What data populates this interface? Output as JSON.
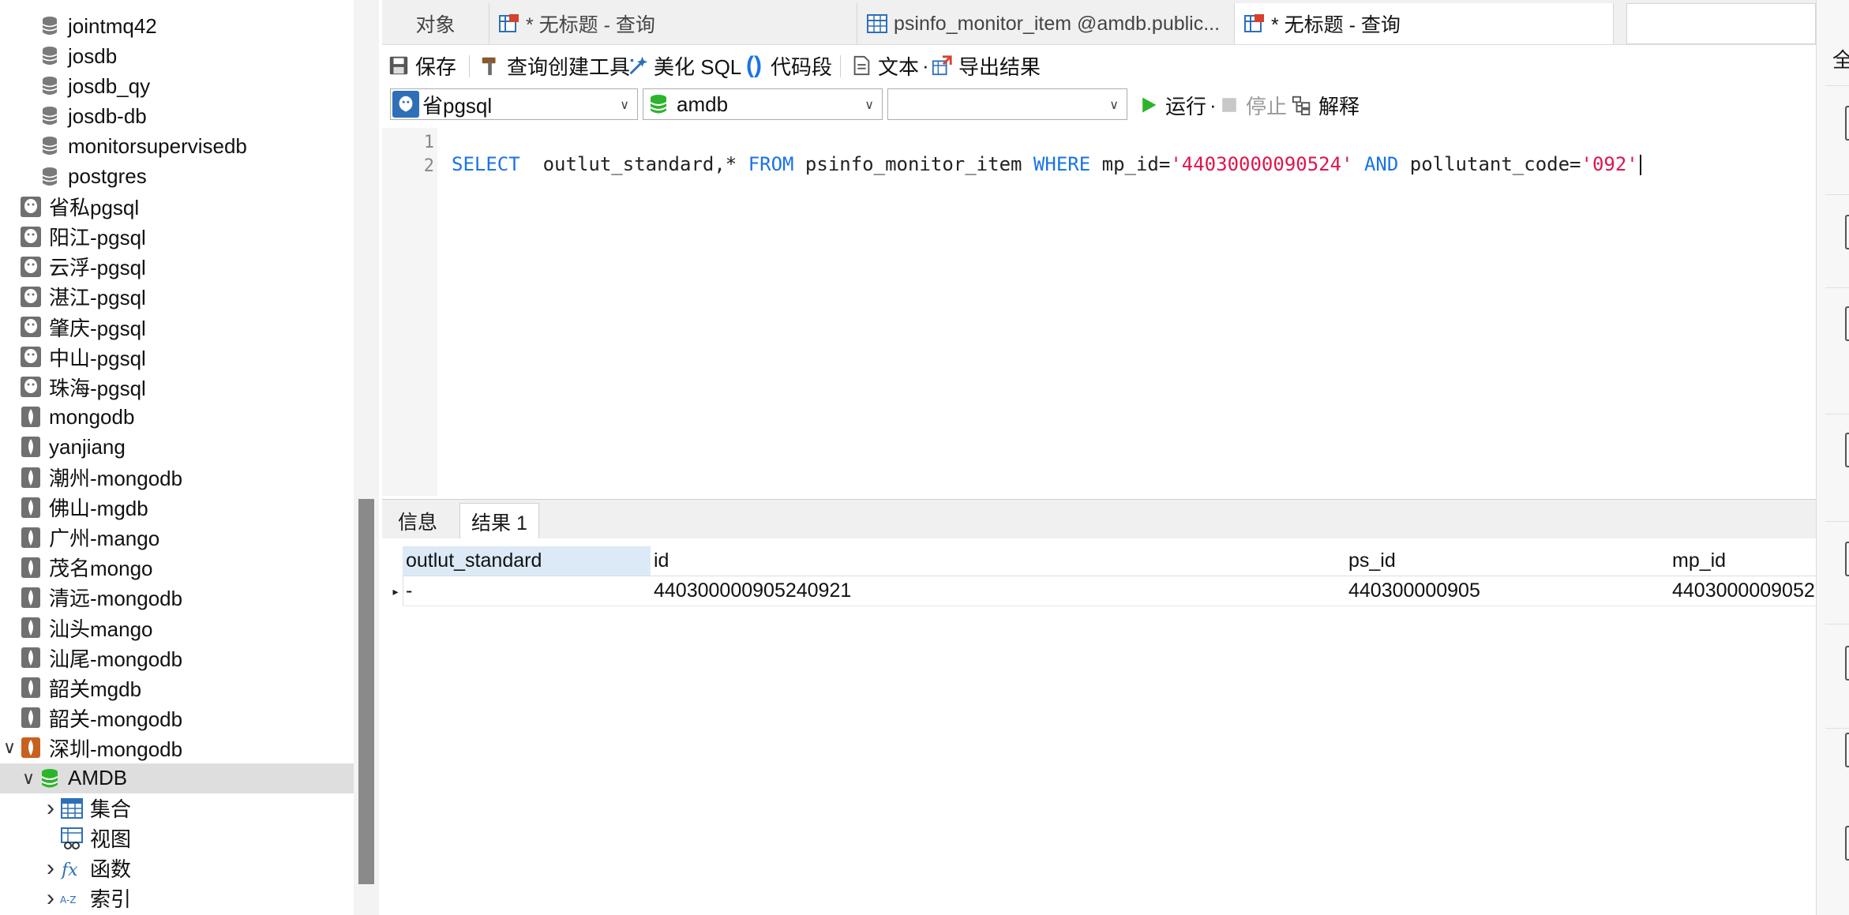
{
  "tree": {
    "items": [
      {
        "label": "jointmq42",
        "type": "db",
        "indent": 2
      },
      {
        "label": "josdb",
        "type": "db",
        "indent": 2
      },
      {
        "label": "josdb_qy",
        "type": "db",
        "indent": 2
      },
      {
        "label": "josdb-db",
        "type": "db",
        "indent": 2
      },
      {
        "label": "monitorsupervisedb",
        "type": "db",
        "indent": 2
      },
      {
        "label": "postgres",
        "type": "db",
        "indent": 2
      },
      {
        "label": "省私pgsql",
        "type": "pg",
        "indent": 1
      },
      {
        "label": "阳江-pgsql",
        "type": "pg",
        "indent": 1
      },
      {
        "label": "云浮-pgsql",
        "type": "pg",
        "indent": 1
      },
      {
        "label": "湛江-pgsql",
        "type": "pg",
        "indent": 1
      },
      {
        "label": "肇庆-pgsql",
        "type": "pg",
        "indent": 1
      },
      {
        "label": "中山-pgsql",
        "type": "pg",
        "indent": 1
      },
      {
        "label": "珠海-pgsql",
        "type": "pg",
        "indent": 1
      },
      {
        "label": "mongodb",
        "type": "mongo",
        "indent": 1
      },
      {
        "label": "yanjiang",
        "type": "mongo",
        "indent": 1
      },
      {
        "label": "潮州-mongodb",
        "type": "mongo",
        "indent": 1
      },
      {
        "label": "佛山-mgdb",
        "type": "mongo",
        "indent": 1
      },
      {
        "label": "广州-mango",
        "type": "mongo",
        "indent": 1
      },
      {
        "label": "茂名mongo",
        "type": "mongo",
        "indent": 1
      },
      {
        "label": "清远-mongodb",
        "type": "mongo",
        "indent": 1
      },
      {
        "label": "汕头mango",
        "type": "mongo",
        "indent": 1
      },
      {
        "label": "汕尾-mongodb",
        "type": "mongo",
        "indent": 1
      },
      {
        "label": "韶关mgdb",
        "type": "mongo",
        "indent": 1
      },
      {
        "label": "韶关-mongodb",
        "type": "mongo",
        "indent": 1
      },
      {
        "label": "深圳-mongodb",
        "type": "mongo-active",
        "indent": 1,
        "expanded": true
      },
      {
        "label": "AMDB",
        "type": "db-green",
        "indent": 2,
        "expanded": true,
        "selected": true
      },
      {
        "label": "集合",
        "type": "table",
        "indent": 3,
        "collapsed": true
      },
      {
        "label": "视图",
        "type": "view",
        "indent": 3
      },
      {
        "label": "函数",
        "type": "func",
        "indent": 3,
        "collapsed": true
      },
      {
        "label": "索引",
        "type": "index",
        "indent": 3,
        "collapsed": true
      }
    ]
  },
  "tabs": [
    {
      "label": "对象",
      "icon": "none"
    },
    {
      "label": "* 无标题 - 查询",
      "icon": "query-icon"
    },
    {
      "label": "psinfo_monitor_item @amdb.public...",
      "icon": "table-icon"
    },
    {
      "label": "* 无标题 - 查询",
      "icon": "query-icon",
      "active": true
    }
  ],
  "toolbar": {
    "save": "保存",
    "query_builder": "查询创建工具",
    "beautify": "美化 SQL",
    "snippet": "代码段",
    "text": "文本",
    "text_suffix": "·",
    "export": "导出结果"
  },
  "selectors": {
    "connection": "省pgsql",
    "database": "amdb",
    "schema": ""
  },
  "run": {
    "run": "运行",
    "run_suffix": "·",
    "stop": "停止",
    "explain": "解释"
  },
  "editor": {
    "line_numbers": [
      "1",
      "2"
    ],
    "sql": {
      "select": "SELECT",
      "cols": "  outlut_standard,* ",
      "from": "FROM",
      "table": " psinfo_monitor_item ",
      "where": "WHERE",
      "cond1": " mp_id=",
      "val1": "'44030000090524'",
      "and": " AND",
      "cond2": " pollutant_code=",
      "val2": "'092'"
    }
  },
  "results": {
    "tabs": [
      "信息",
      "结果 1"
    ],
    "columns": [
      "outlut_standard",
      "id",
      "ps_id",
      "mp_id"
    ],
    "rows": [
      [
        "-",
        "440300000905240921",
        "440300000905",
        "4403000009052"
      ]
    ]
  },
  "right_panel": {
    "label": "全"
  },
  "colors": {
    "keyword": "#1a73e8",
    "string": "#e0144c",
    "run_green": "#2db42d",
    "mongo_active": "#c8601e"
  }
}
